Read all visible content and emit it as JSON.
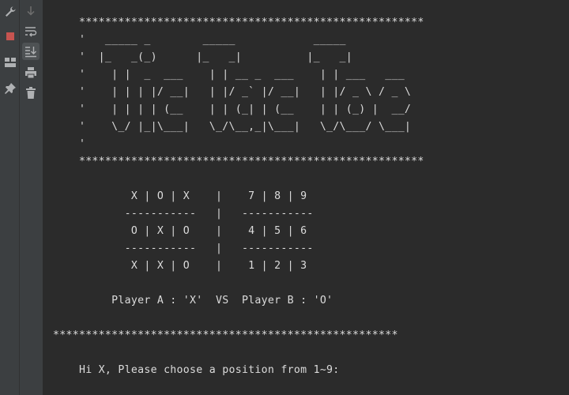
{
  "toolbar_left": {
    "buttons": [
      {
        "name": "wrench-icon"
      },
      {
        "name": "stop-icon",
        "color": "#c75450"
      },
      {
        "name": "layout-icon"
      },
      {
        "name": "pin-icon"
      }
    ]
  },
  "toolbar_second": {
    "buttons": [
      {
        "name": "arrow-down-icon"
      },
      {
        "name": "soft-wrap-icon"
      },
      {
        "name": "scroll-to-end-icon"
      },
      {
        "name": "print-icon"
      },
      {
        "name": "trash-icon"
      }
    ]
  },
  "console": {
    "lines": [
      "    *****************************************************",
      "    '   _____ _        _____            _____",
      "    '  |_   _(_)      |_   _|          |_   _|",
      "    '    | |  _  ___    | | __ _  ___    | | ___   ___",
      "    '    | | | |/ __|   | |/ _` |/ __|   | |/ _ \\ / _ \\",
      "    '    | | | | (__    | | (_| | (__    | | (_) |  __/",
      "    '    \\_/ |_|\\___|   \\_/\\__,_|\\___|   \\_/\\___/ \\___|",
      "    '",
      "    *****************************************************",
      "",
      "            X | O | X    |    7 | 8 | 9",
      "           -----------   |   -----------",
      "            O | X | O    |    4 | 5 | 6",
      "           -----------   |   -----------",
      "            X | X | O    |    1 | 2 | 3",
      "",
      "         Player A : 'X'  VS  Player B : 'O'",
      "",
      "*****************************************************",
      "",
      "    Hi X, Please choose a position from 1~9:"
    ]
  },
  "colors": {
    "background": "#2b2b2b",
    "toolbar": "#3c3f41",
    "text": "#dcdcdc",
    "icon": "#afb1b3"
  }
}
